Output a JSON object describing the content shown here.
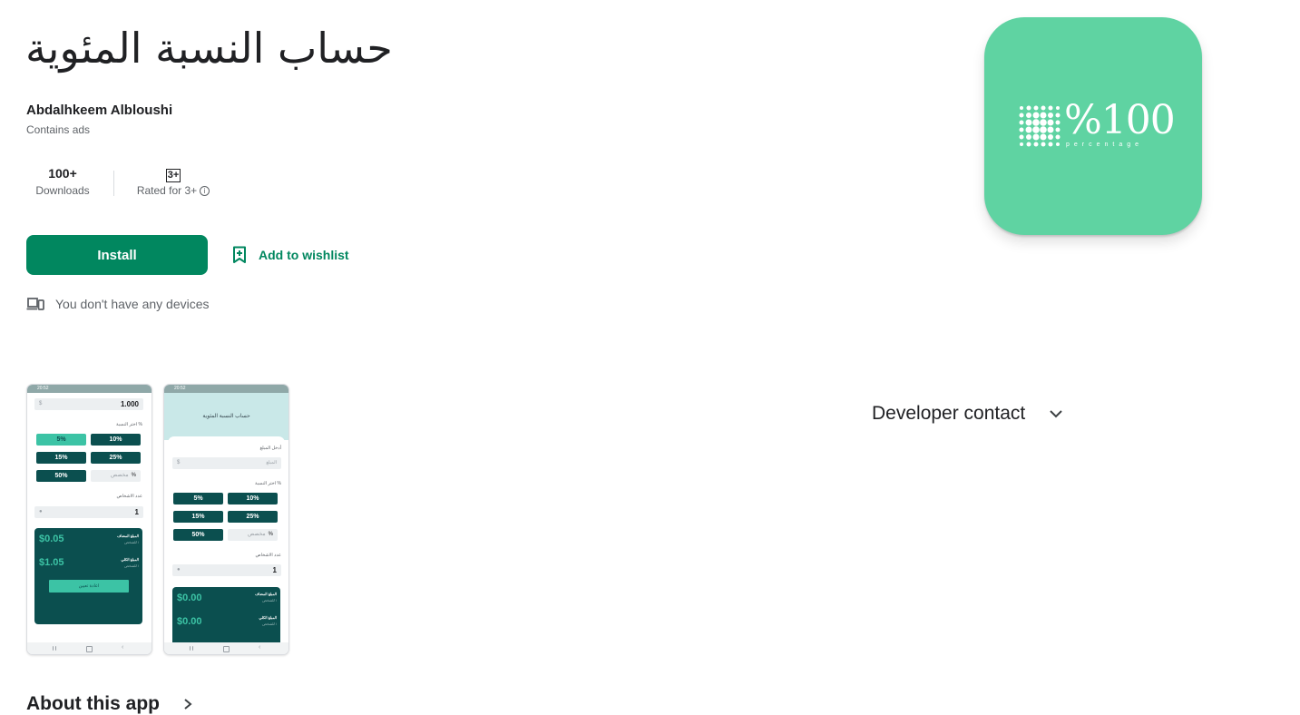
{
  "app": {
    "title": "حساب النسبة المئوية",
    "developer": "Abdalhkeem Albloushi",
    "ads_notice": "Contains ads"
  },
  "stats": {
    "downloads_value": "100+",
    "downloads_label": "Downloads",
    "rating_value": "3+",
    "rating_label": "Rated for 3+"
  },
  "actions": {
    "install_label": "Install",
    "wishlist_label": "Add to wishlist",
    "devices_text": "You don't have any devices"
  },
  "icon": {
    "main_text": "%100",
    "sub_text": "percentage",
    "background_color": "#5fd3a2"
  },
  "developer_contact": {
    "label": "Developer contact"
  },
  "about": {
    "label": "About this app"
  },
  "screenshots": {
    "shot1": {
      "status_time": "20:52",
      "amount": "1.000",
      "currency": "$",
      "choose_pct": "اختر النسبة %",
      "pct": [
        "5%",
        "10%",
        "15%",
        "25%",
        "50%"
      ],
      "custom": "مخصص",
      "custom_symbol": "%",
      "people_label": "عدد الاشخاص",
      "people": "1",
      "result_1": "$0.05",
      "result_1_caption": "المبلغ المضاف",
      "result_1_sub": "للشخص /",
      "result_2": "$1.05",
      "result_2_caption": "المبلغ الكلي",
      "result_2_sub": "للشخص /",
      "reset": "اعادة تعيين"
    },
    "shot2": {
      "status_time": "20:52",
      "header": "حساب النسبة المئوية",
      "enter_amount": "أدخل المبلغ",
      "amount_placeholder": "المبلغ",
      "currency": "$",
      "choose_pct": "اختر النسبة %",
      "pct": [
        "5%",
        "10%",
        "15%",
        "25%",
        "50%"
      ],
      "custom": "مخصص",
      "custom_symbol": "%",
      "people_label": "عدد الاشخاص",
      "people": "1",
      "result_1": "$0.00",
      "result_1_caption": "المبلغ المضاف",
      "result_1_sub": "للشخص /",
      "result_2": "$0.00",
      "result_2_caption": "المبلغ الكلي",
      "result_2_sub": "للشخص /"
    }
  },
  "colors": {
    "accent": "#01875f",
    "dark_teal": "#0b4f4f",
    "teal": "#3cc3a5"
  }
}
